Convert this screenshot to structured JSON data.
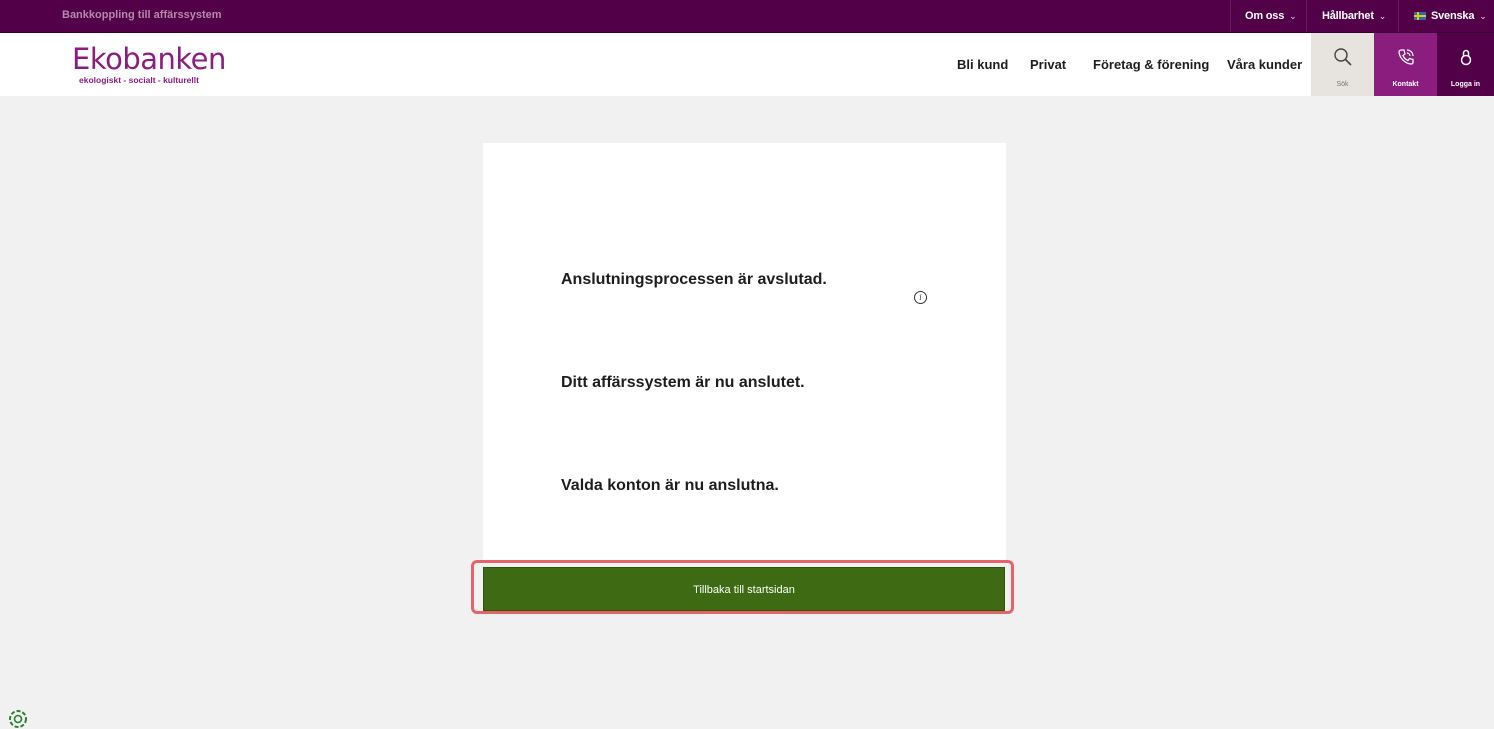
{
  "topbar": {
    "breadcrumb": "Bankkoppling till affärssystem",
    "menu_about": "Om oss",
    "menu_sustainability": "Hållbarhet",
    "menu_language": "Svenska"
  },
  "header": {
    "logo_name": "Ekobanken",
    "logo_tagline": "ekologiskt - socialt - kulturellt",
    "nav": [
      "Bli kund",
      "Privat",
      "Företag & förening",
      "Våra kunder"
    ],
    "search_label": "Sök",
    "contact_label": "Kontakt",
    "login_label": "Logga in"
  },
  "main": {
    "lines": [
      "Anslutningsprocessen är avslutad.",
      "Ditt affärssystem är nu anslutet.",
      "Valda konton är nu anslutna."
    ],
    "info_symbol": "i",
    "button_label": "Tillbaka till startsidan"
  },
  "colors": {
    "brand_purple": "#520047",
    "logo_purple": "#8a1d7d",
    "button_green": "#3d6a13",
    "highlight_red": "#e4646a"
  }
}
